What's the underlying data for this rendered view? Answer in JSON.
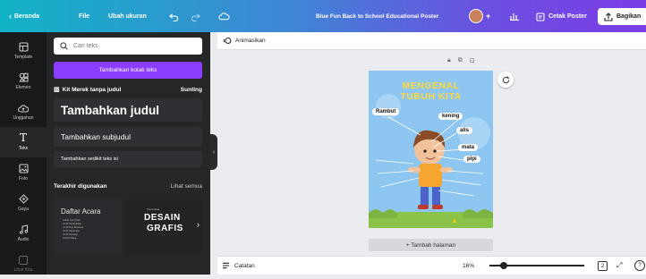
{
  "topbar": {
    "home": "Beranda",
    "file": "File",
    "resize": "Ubah ukuran",
    "design_title": "Blue Fun Back to School Educational Poster",
    "print": "Cetak Poster",
    "share": "Bagikan"
  },
  "rail": [
    {
      "label": "Template",
      "icon": "template-icon"
    },
    {
      "label": "Elemen",
      "icon": "elements-icon"
    },
    {
      "label": "Unggahan",
      "icon": "upload-icon"
    },
    {
      "label": "Teks",
      "icon": "text-icon"
    },
    {
      "label": "Foto",
      "icon": "photo-icon"
    },
    {
      "label": "Gaya",
      "icon": "styles-icon"
    },
    {
      "label": "Audio",
      "icon": "audio-icon"
    },
    {
      "label": "Lihat Kita",
      "icon": "more-icon"
    }
  ],
  "panel": {
    "search_placeholder": "Cari teks",
    "add_textbox": "Tambahkan kotak teks",
    "brand_kit": "Kit Merek tanpa judul",
    "edit": "Sunting",
    "heading": "Tambahkan judul",
    "subheading": "Tambahkan subjudul",
    "body": "Tambahkan sedikit teks isi",
    "recent": "Terakhir digunakan",
    "see_all": "Lihat semua",
    "thumb1": {
      "title": "Daftar Acara",
      "lines": [
        "Leluar Cuti Upah",
        "12.00 Pembukaan",
        "13.30 Doa Bersama",
        "14.00 Sambutan",
        "15.00 Penutup",
        "16.00 Pulang"
      ]
    },
    "thumb2": {
      "small": "Komunitas",
      "line1": "DESAIN",
      "line2": "GRAFIS"
    }
  },
  "canvas": {
    "animate": "Animasikan",
    "poster_title_1": "MENGENAL",
    "poster_title_2": "TUBUH KITA",
    "labels": [
      "Rambut",
      "kening",
      "alis",
      "mata",
      "pipi"
    ],
    "add_page": "+ Tambah halaman"
  },
  "bottombar": {
    "notes": "Catatan",
    "zoom": "16%",
    "page_number": "2"
  },
  "colors": {
    "accent": "#8b3dff",
    "rail_bg": "#18191b",
    "panel_bg": "#252627",
    "poster_sky": "#8dc6f0"
  }
}
